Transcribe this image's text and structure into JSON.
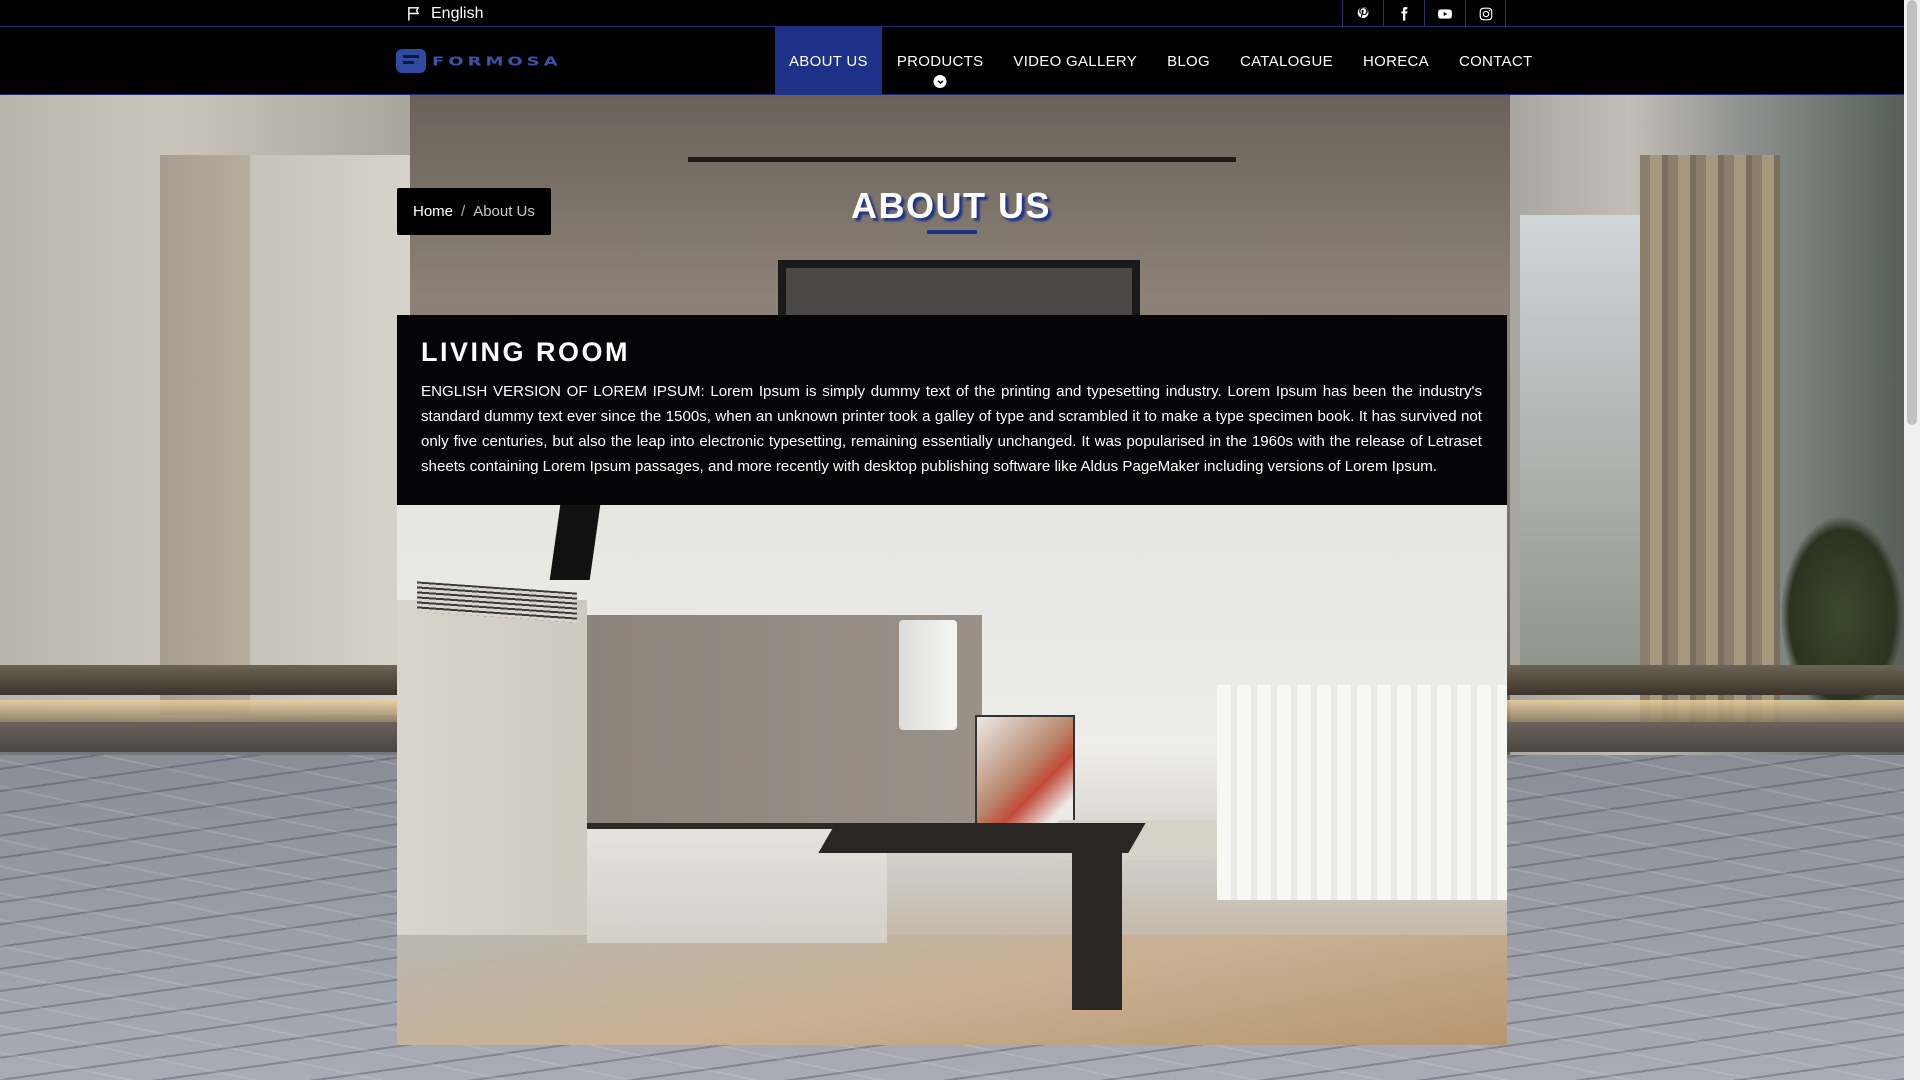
{
  "topbar": {
    "language": "English",
    "socials": [
      {
        "name": "pinterest-icon"
      },
      {
        "name": "facebook-icon"
      },
      {
        "name": "youtube-icon"
      },
      {
        "name": "instagram-icon"
      }
    ]
  },
  "brand": {
    "logo_text": "FORMOSA"
  },
  "nav": {
    "items": [
      {
        "label": "ABOUT US",
        "active": true
      },
      {
        "label": "PRODUCTS",
        "has_dropdown": true
      },
      {
        "label": "VIDEO GALLERY"
      },
      {
        "label": "BLOG"
      },
      {
        "label": "CATALOGUE"
      },
      {
        "label": "HORECA"
      },
      {
        "label": "CONTACT"
      }
    ]
  },
  "breadcrumb": {
    "home": "Home",
    "separator": "/",
    "current": "About Us"
  },
  "page": {
    "title": "ABOUT US"
  },
  "section": {
    "title": "LIVING ROOM",
    "body": "ENGLISH VERSION OF LOREM IPSUM: Lorem Ipsum is simply dummy text of the printing and typesetting industry. Lorem Ipsum has been the industry's standard dummy text ever since the 1500s, when an unknown printer took a galley of type and scrambled it to make a type specimen book. It has survived not only five centuries, but also the leap into electronic typesetting, remaining essentially unchanged. It was popularised in the 1960s with the release of Letraset sheets containing Lorem Ipsum passages, and more recently with desktop publishing software like Aldus PageMaker including versions of Lorem Ipsum."
  },
  "colors": {
    "accent": "#1d3188",
    "background": "#000000",
    "text": "#ffffff"
  }
}
